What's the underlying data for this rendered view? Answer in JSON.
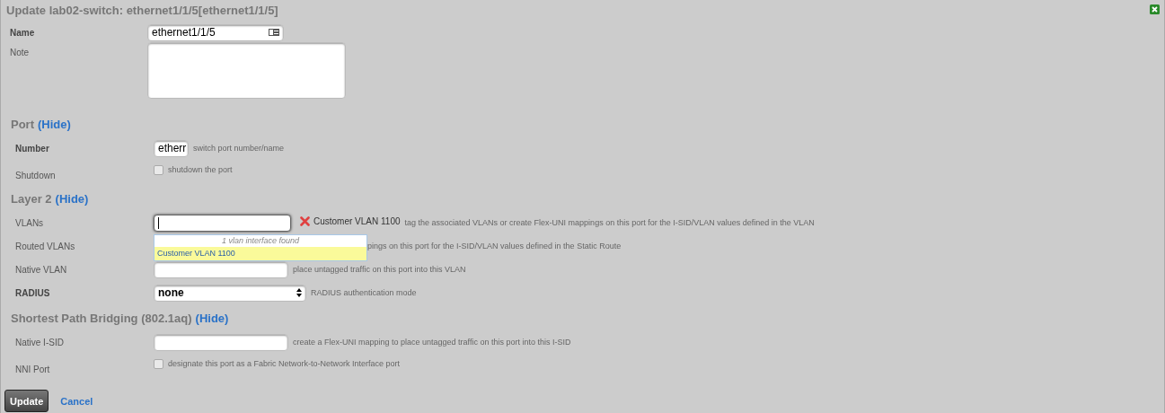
{
  "window": {
    "title": "Update lab02-switch: ethernet1/1/5[ethernet1/1/5]"
  },
  "top_fields": [
    {
      "kind": "text",
      "label": "Name",
      "bold": true,
      "value": "ethernet1/1/5"
    },
    {
      "kind": "textarea",
      "label": "Note",
      "bold": false
    }
  ],
  "sections": [
    {
      "title": "Port",
      "toggle": "(Hide)",
      "rows": [
        {
          "kind": "short",
          "label": "Number",
          "bold": true,
          "value": "etherr",
          "help": "switch port number/name"
        },
        {
          "kind": "checkbox",
          "label": "Shutdown",
          "bold": false,
          "checked": false,
          "help": "shutdown the port"
        }
      ]
    },
    {
      "title": "Layer 2",
      "toggle": "(Hide)",
      "rows": [
        {
          "kind": "tokens",
          "label": "VLANs",
          "bold": false,
          "token": "Customer VLAN 1100",
          "help": "tag the associated VLANs or create Flex-UNI mappings on this port for the I-SID/VLAN values defined in the VLAN",
          "dropdown": {
            "status": "1 vlan interface found",
            "options": [
              {
                "label": "Customer VLAN 1100",
                "selected": true
              }
            ]
          }
        },
        {
          "kind": "covered",
          "label": "Routed VLANs",
          "bold": false,
          "help": "pings on this port for the I-SID/VLAN values defined in the Static Route"
        },
        {
          "kind": "text",
          "label": "Native VLAN",
          "bold": false,
          "help": "place untagged traffic on this port into this VLAN"
        },
        {
          "kind": "select",
          "label": "RADIUS",
          "bold": true,
          "value": "none",
          "help": "RADIUS authentication mode"
        }
      ]
    },
    {
      "title": "Shortest Path Bridging (802.1aq)",
      "toggle": "(Hide)",
      "rows": [
        {
          "kind": "text",
          "label": "Native I-SID",
          "bold": false,
          "help": "create a Flex-UNI mapping to place untagged traffic on this port into this I-SID"
        },
        {
          "kind": "checkbox",
          "label": "NNI Port",
          "bold": false,
          "checked": false,
          "help": "designate this port as a Fabric Network-to-Network Interface port"
        }
      ]
    }
  ],
  "actions": {
    "submit": "Update",
    "cancel": "Cancel"
  }
}
